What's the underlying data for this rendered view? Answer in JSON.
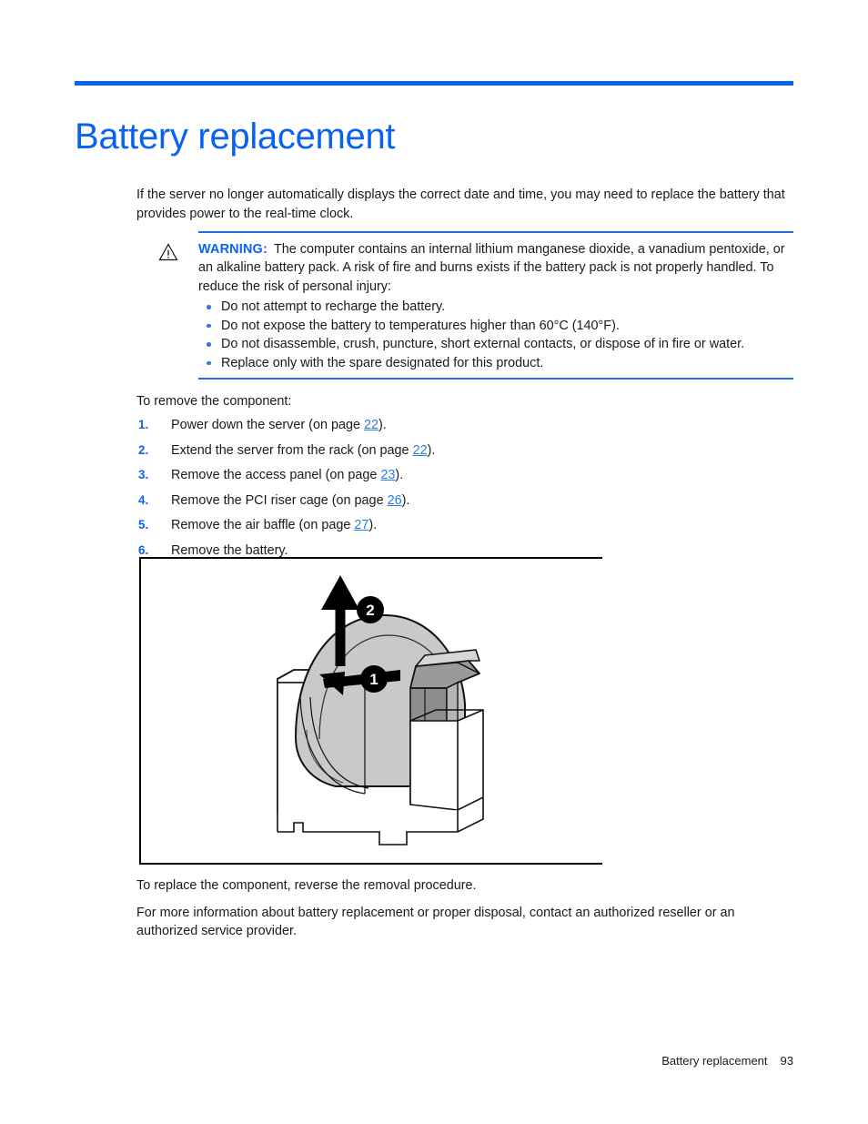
{
  "document": {
    "title": "Battery replacement",
    "accent_color": "#0a62f0",
    "rule_color": "#0a62f0"
  },
  "intro": {
    "paragraph": "If the server no longer automatically displays the correct date and time, you may need to replace the battery that provides power to the real-time clock."
  },
  "warning": {
    "icon": "warning-triangle-icon",
    "label": "WARNING:",
    "text": "The computer contains an internal lithium manganese dioxide, a vanadium pentoxide, or an alkaline battery pack. A risk of fire and burns exists if the battery pack is not properly handled. To reduce the risk of personal injury:",
    "bullets": [
      "Do not attempt to recharge the battery.",
      "Do not expose the battery to temperatures higher than 60°C (140°F).",
      "Do not disassemble, crush, puncture, short external contacts, or dispose of in fire or water.",
      "Replace only with the spare designated for this product."
    ]
  },
  "procedure": {
    "lead_in": "To remove the component:",
    "steps": [
      {
        "num": "1.",
        "text_before": "Power down the server (on page ",
        "xref": "22",
        "text_after": ")."
      },
      {
        "num": "2.",
        "text_before": "Extend the server from the rack (on page ",
        "xref": "22",
        "text_after": ")."
      },
      {
        "num": "3.",
        "text_before": "Remove the access panel (on page ",
        "xref": "23",
        "text_after": ")."
      },
      {
        "num": "4.",
        "text_before": "Remove the PCI riser cage (on page ",
        "xref": "26",
        "text_after": ")."
      },
      {
        "num": "5.",
        "text_before": "Remove the air baffle (on page ",
        "xref": "27",
        "text_after": ")."
      },
      {
        "num": "6.",
        "text_before": "Remove the battery.",
        "xref": "",
        "text_after": ""
      }
    ]
  },
  "figure": {
    "name": "battery-removal-illustration",
    "callouts": [
      {
        "id": "1",
        "meaning": "release-latch"
      },
      {
        "id": "2",
        "meaning": "lift-battery-out"
      }
    ]
  },
  "tail": {
    "replace_note": "To replace the component, reverse the removal procedure.",
    "disposal_note": "For more information about battery replacement or proper disposal, contact an authorized reseller or an authorized service provider."
  },
  "footer": {
    "chapter": "Battery replacement",
    "page_number": "93"
  }
}
